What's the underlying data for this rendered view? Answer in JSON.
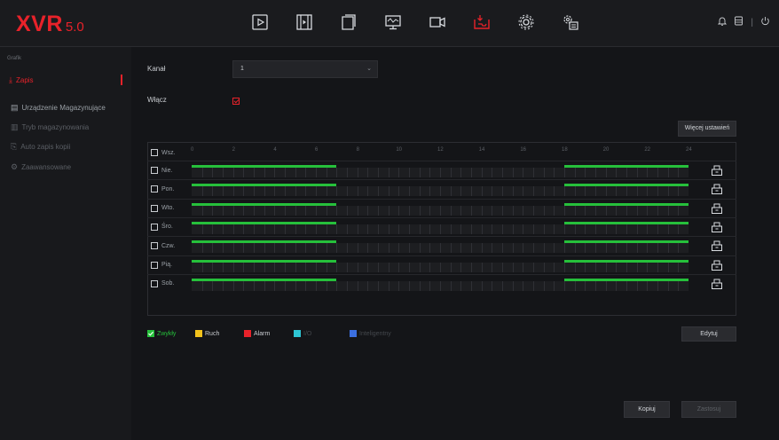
{
  "header": {
    "logo_text": "XVR",
    "logo_version": "5.0",
    "nav_icons": [
      "playback-icon",
      "film-icon",
      "files-icon",
      "display-icon",
      "camera-icon",
      "record-icon",
      "settings-icon",
      "advanced-settings-icon"
    ],
    "right_icons": [
      "bell-icon",
      "server-icon",
      "separator",
      "power-icon"
    ],
    "separator": "|"
  },
  "sidebar": {
    "heading": "Grafik",
    "items": [
      {
        "label": "Zapis",
        "icon": "record-icon",
        "state": "active"
      },
      {
        "label": "Urządzenie Magazynujące",
        "icon": "storage-icon",
        "state": "normal"
      },
      {
        "label": "Tryb magazynowania",
        "icon": "storage-mode-icon",
        "state": "dim"
      },
      {
        "label": "Auto zapis kopii",
        "icon": "backup-icon",
        "state": "dim"
      },
      {
        "label": "Zaawansowane",
        "icon": "advanced-icon",
        "state": "dim"
      }
    ]
  },
  "main": {
    "channel_label": "Kanał",
    "channel_value": "1",
    "enable_label": "Włącz",
    "enable_checked": true,
    "more_settings_label": "Więcej ustawień",
    "select_all_label": "Wsz.",
    "hours": [
      "0",
      "2",
      "4",
      "6",
      "8",
      "10",
      "12",
      "14",
      "16",
      "18",
      "20",
      "22",
      "24"
    ],
    "days": [
      "Nie.",
      "Pon.",
      "Wto.",
      "Śro.",
      "Czw.",
      "Pią.",
      "Sob."
    ],
    "legend": [
      {
        "label": "Zwykły",
        "color": "#26c03b",
        "checked": true
      },
      {
        "label": "Ruch",
        "color": "#f2c21c",
        "checked": false
      },
      {
        "label": "Alarm",
        "color": "#e8222a",
        "checked": false
      },
      {
        "label": "I/O",
        "color": "#2ec6d4",
        "checked": false
      },
      {
        "label": "Inteligentny",
        "color": "#3b6fe0",
        "checked": false
      }
    ],
    "edit_label": "Edytuj",
    "copy_label": "Kopiuj",
    "apply_label": "Zastosuj",
    "colors": {
      "accent": "#e8222a",
      "schedule": "#26c03b"
    }
  }
}
